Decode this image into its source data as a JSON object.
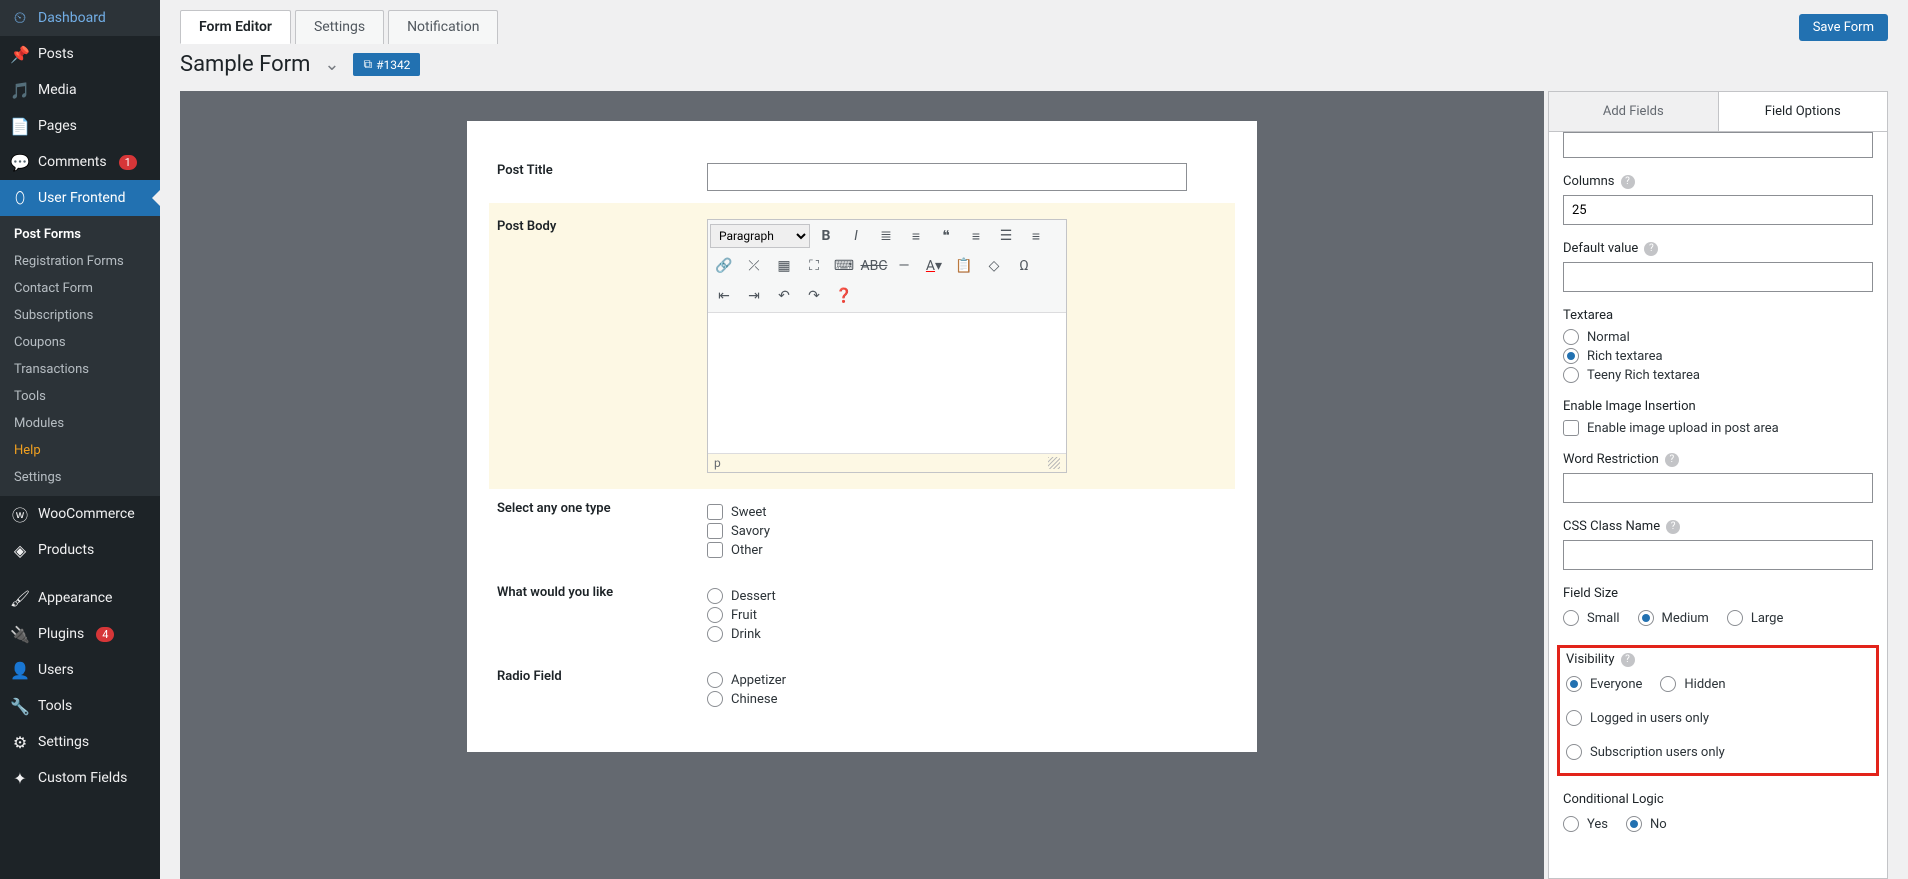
{
  "sidebar": {
    "items": [
      {
        "label": "Dashboard",
        "icon": "🏠"
      },
      {
        "label": "Posts",
        "icon": "📌"
      },
      {
        "label": "Media",
        "icon": "🖼"
      },
      {
        "label": "Pages",
        "icon": "📄"
      },
      {
        "label": "Comments",
        "icon": "💬",
        "badge": "1"
      },
      {
        "label": "User Frontend",
        "icon": "👤",
        "active": true
      },
      {
        "label": "WooCommerce",
        "icon": "🛒"
      },
      {
        "label": "Products",
        "icon": "📦"
      },
      {
        "label": "Appearance",
        "icon": "🎨"
      },
      {
        "label": "Plugins",
        "icon": "🔌",
        "badge": "4"
      },
      {
        "label": "Users",
        "icon": "👥"
      },
      {
        "label": "Tools",
        "icon": "🔧"
      },
      {
        "label": "Settings",
        "icon": "⚙"
      },
      {
        "label": "Custom Fields",
        "icon": "✦"
      }
    ],
    "submenu": [
      {
        "label": "Post Forms",
        "current": true
      },
      {
        "label": "Registration Forms"
      },
      {
        "label": "Contact Form"
      },
      {
        "label": "Subscriptions"
      },
      {
        "label": "Coupons"
      },
      {
        "label": "Transactions"
      },
      {
        "label": "Tools"
      },
      {
        "label": "Modules"
      },
      {
        "label": "Help",
        "highlight": true
      },
      {
        "label": "Settings"
      }
    ]
  },
  "tabs": [
    {
      "label": "Form Editor",
      "active": true
    },
    {
      "label": "Settings"
    },
    {
      "label": "Notification"
    }
  ],
  "save_button": "Save Form",
  "form_title": "Sample Form",
  "form_id": "#1342",
  "fields": {
    "post_title": {
      "label": "Post Title"
    },
    "post_body": {
      "label": "Post Body",
      "format_select": "Paragraph",
      "status": "p"
    },
    "select_type": {
      "label": "Select any one type",
      "options": [
        "Sweet",
        "Savory",
        "Other"
      ]
    },
    "what_like": {
      "label": "What would you like",
      "options": [
        "Dessert",
        "Fruit",
        "Drink"
      ]
    },
    "radio_field": {
      "label": "Radio Field",
      "options": [
        "Appetizer",
        "Chinese"
      ]
    }
  },
  "panel_tabs": [
    {
      "label": "Add Fields"
    },
    {
      "label": "Field Options",
      "active": true
    }
  ],
  "options": {
    "columns": {
      "label": "Columns",
      "value": "25"
    },
    "default_value": {
      "label": "Default value"
    },
    "textarea": {
      "label": "Textarea",
      "options": [
        "Normal",
        "Rich textarea",
        "Teeny Rich textarea"
      ],
      "selected": "Rich textarea"
    },
    "enable_image": {
      "label": "Enable Image Insertion",
      "checkbox": "Enable image upload in post area"
    },
    "word_restriction": {
      "label": "Word Restriction"
    },
    "css_class": {
      "label": "CSS Class Name"
    },
    "field_size": {
      "label": "Field Size",
      "options": [
        "Small",
        "Medium",
        "Large"
      ],
      "selected": "Medium"
    },
    "visibility": {
      "label": "Visibility",
      "options": [
        "Everyone",
        "Hidden",
        "Logged in users only",
        "Subscription users only"
      ],
      "selected": "Everyone"
    },
    "conditional": {
      "label": "Conditional Logic",
      "options": [
        "Yes",
        "No"
      ],
      "selected": "No"
    }
  }
}
